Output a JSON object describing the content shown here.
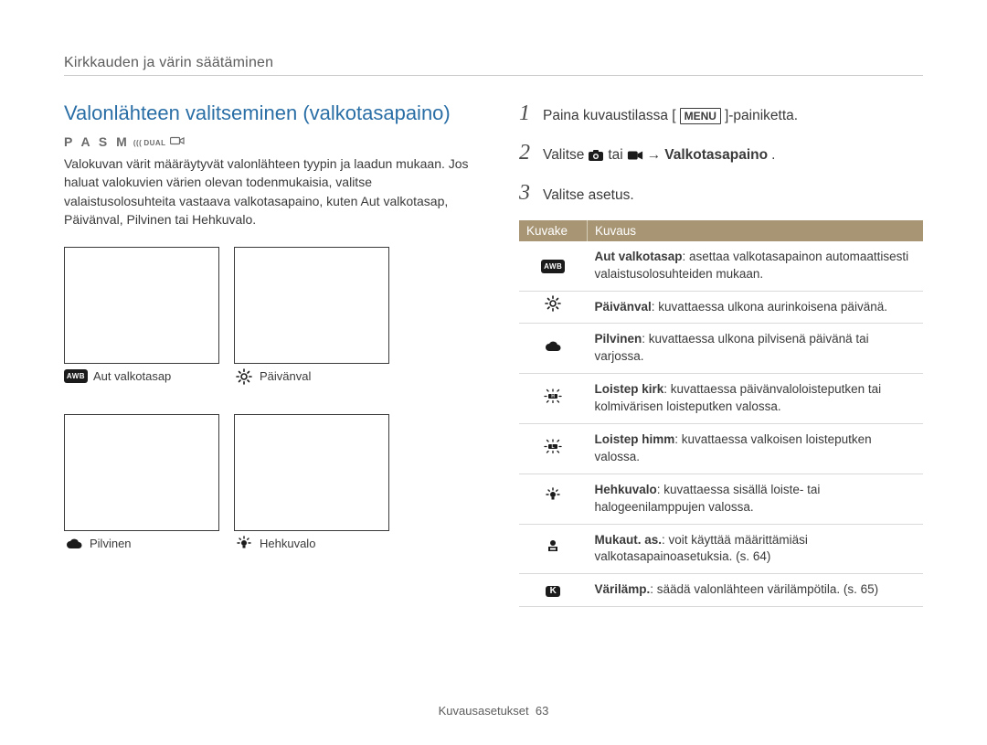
{
  "breadcrumb": "Kirkkauden ja värin säätäminen",
  "section": {
    "title": "Valonlähteen valitseminen (valkotasapaino)",
    "mode_letters": "P A S M",
    "mode_dual": "DUAL",
    "paragraph": "Valokuvan värit määräytyvät valonlähteen tyypin ja laadun mukaan. Jos haluat valokuvien värien olevan todenmukaisia, valitse valaistusolosuhteita vastaava valkotasapaino, kuten Aut valkotasap, Päivänval, Pilvinen tai Hehkuvalo."
  },
  "thumbs": {
    "awb_label": "Aut valkotasap",
    "awb_badge": "AWB",
    "daylight_label": "Päivänval",
    "cloudy_label": "Pilvinen",
    "tungsten_label": "Hehkuvalo"
  },
  "steps": {
    "s1_a": "Paina kuvaustilassa [",
    "s1_menu": "MENU",
    "s1_b": "]-painiketta.",
    "s2_a": "Valitse",
    "s2_b": "tai",
    "s2_c": "→",
    "s2_d": "Valkotasapaino",
    "s2_e": ".",
    "s3": "Valitse asetus."
  },
  "table": {
    "head_icon": "Kuvake",
    "head_desc": "Kuvaus",
    "rows": [
      {
        "icon": "awb",
        "title": "Aut valkotasap",
        "desc": ": asettaa valkotasapainon automaattisesti valaistusolosuhteiden mukaan."
      },
      {
        "icon": "daylight",
        "title": "Päivänval",
        "desc": ": kuvattaessa ulkona aurinkoisena päivänä."
      },
      {
        "icon": "cloudy",
        "title": "Pilvinen",
        "desc": ": kuvattaessa ulkona pilvisenä päivänä tai varjossa."
      },
      {
        "icon": "fluoH",
        "title": "Loistep kirk",
        "desc": ": kuvattaessa päivänvaloloisteputken tai kolmivärisen loisteputken valossa."
      },
      {
        "icon": "fluoL",
        "title": "Loistep himm",
        "desc": ": kuvattaessa valkoisen loisteputken valossa."
      },
      {
        "icon": "tungsten",
        "title": "Hehkuvalo",
        "desc": ": kuvattaessa sisällä loiste- tai halogeenilamppujen valossa."
      },
      {
        "icon": "custom",
        "title": "Mukaut. as.",
        "desc": ": voit käyttää määrittämiäsi valkotasapainoasetuksia. (s. 64)"
      },
      {
        "icon": "k",
        "title": "Värilämp.",
        "desc": ": säädä valonlähteen värilämpötila. (s. 65)"
      }
    ]
  },
  "footer": {
    "section": "Kuvausasetukset",
    "page": "63"
  },
  "icons": {
    "k_label": "K"
  }
}
